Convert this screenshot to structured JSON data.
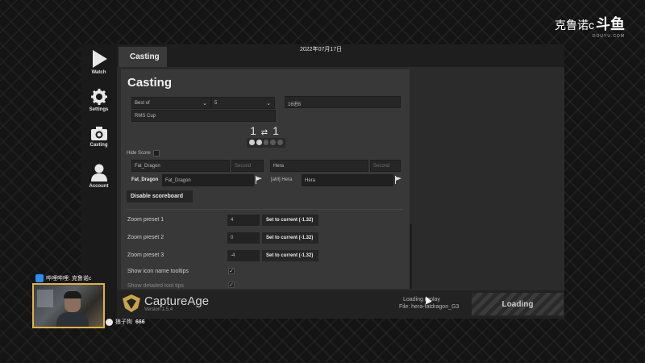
{
  "stream": {
    "logo_text": "克鲁诺c",
    "brand": "斗鱼",
    "brand_sub": "DOUYU.COM",
    "chat_user": "哔哩哔哩: 克鲁诺c",
    "viewer_name": "狼子狗",
    "viewer_count": "666"
  },
  "window": {
    "tab": "Casting",
    "date": "2022年07月17日"
  },
  "nav": [
    {
      "label": "Watch",
      "icon": "play-icon"
    },
    {
      "label": "Settings",
      "icon": "gear-icon"
    },
    {
      "label": "Casting",
      "icon": "camera-icon"
    },
    {
      "label": "Account",
      "icon": "person-icon"
    }
  ],
  "casting": {
    "title": "Casting",
    "best_of_label": "Best of",
    "best_of_value": "5",
    "round_field": "16进8",
    "cup_field": "RMS Cup",
    "score_left": "1",
    "score_right": "1",
    "score_swap_icon": "swap-icon",
    "game_dots": [
      true,
      true,
      false,
      false,
      false
    ],
    "hide_score_label": "Hide Score",
    "player1": {
      "name_field": "Fat_Dragon",
      "secondary_placeholder": "Second",
      "tag_label": "Fat_Dragon",
      "display_field": "Fat_Dragon"
    },
    "player2": {
      "name_field": "Hera",
      "secondary_placeholder": "Second",
      "tag_label": "[aM] Hera",
      "display_field": "Hera"
    },
    "disable_scoreboard": "Disable scoreboard",
    "zoom_presets": [
      {
        "label": "Zoom preset 1",
        "value": "4",
        "button": "Set to current (-1.32)"
      },
      {
        "label": "Zoom preset 2",
        "value": "0",
        "button": "Set to current (-1.32)"
      },
      {
        "label": "Zoom preset 3",
        "value": "-4",
        "button": "Set to current (-1.32)"
      }
    ],
    "icon_tooltips_label": "Show icon name tooltips",
    "detailed_label": "Show detailed tool tips"
  },
  "footer": {
    "app_name": "CaptureAge",
    "version": "Version 1.5.4",
    "loading_msg": "Loading replay",
    "loading_file": "File: hera-fatdragon_G3",
    "loading_button": "Loading"
  }
}
